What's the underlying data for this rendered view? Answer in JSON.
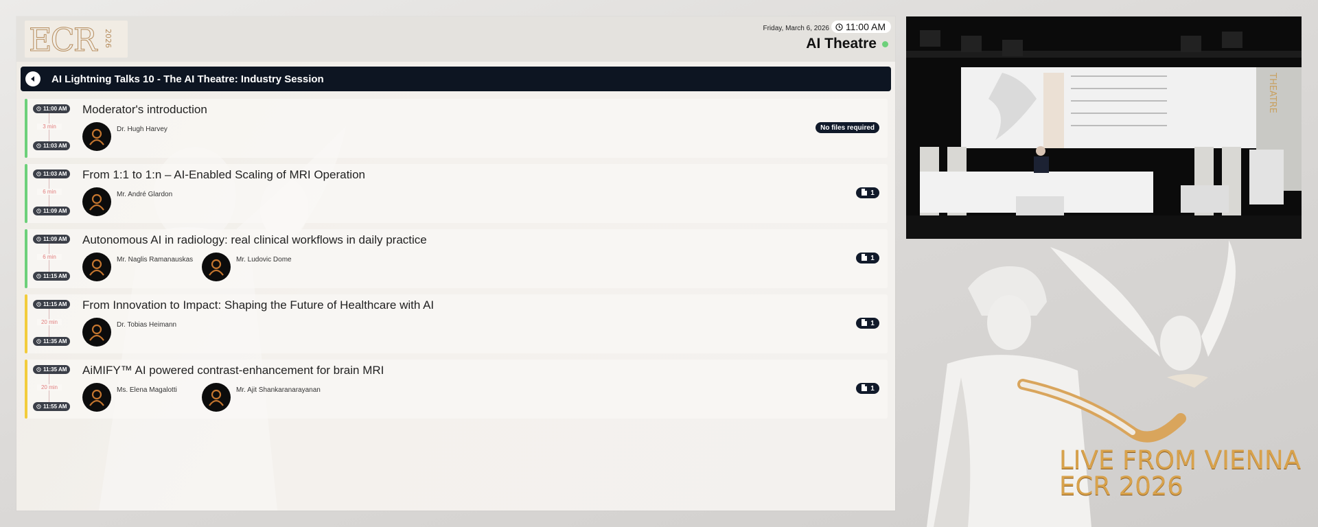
{
  "header": {
    "logo_text": "ECR 2026",
    "date": "Friday, March 6, 2026",
    "time": "11:00 AM",
    "room": "AI Theatre"
  },
  "session": {
    "title": "AI Lightning Talks 10 - The AI Theatre: Industry Session"
  },
  "talks": [
    {
      "start": "11:00 AM",
      "end": "11:03 AM",
      "duration": "3 min",
      "title": "Moderator's introduction",
      "speakers": [
        "Dr. Hugh Harvey"
      ],
      "files": "No files required",
      "bar_color": "#6dd07a"
    },
    {
      "start": "11:03 AM",
      "end": "11:09 AM",
      "duration": "6 min",
      "title": "From 1:1 to 1:n – AI-Enabled Scaling of MRI Operation",
      "speakers": [
        "Mr. André Glardon"
      ],
      "files": "1",
      "bar_color": "#6dd07a"
    },
    {
      "start": "11:09 AM",
      "end": "11:15 AM",
      "duration": "6 min",
      "title": "Autonomous AI in radiology: real clinical workflows in daily practice",
      "speakers": [
        "Mr. Naglis Ramanauskas",
        "Mr. Ludovic Dome"
      ],
      "files": "1",
      "bar_color": "#6dd07a"
    },
    {
      "start": "11:15 AM",
      "end": "11:35 AM",
      "duration": "20 min",
      "title": "From Innovation to Impact: Shaping the Future of Healthcare with AI",
      "speakers": [
        "Dr. Tobias Heimann"
      ],
      "files": "1",
      "bar_color": "#f2cc3c"
    },
    {
      "start": "11:35 AM",
      "end": "11:55 AM",
      "duration": "20 min",
      "title": "AiMIFY™ AI powered contrast-enhancement for brain MRI",
      "speakers": [
        "Ms. Elena Magalotti",
        "Mr. Ajit Shankaranarayanan"
      ],
      "files": "1",
      "bar_color": "#f2cc3c"
    }
  ],
  "overlay": {
    "line1": "LIVE FROM VIENNA",
    "line2": "ECR 2026"
  },
  "colors": {
    "accent_live": "#6dd07a",
    "session_bar": "#0d1522",
    "gold": "#d8a24c"
  }
}
